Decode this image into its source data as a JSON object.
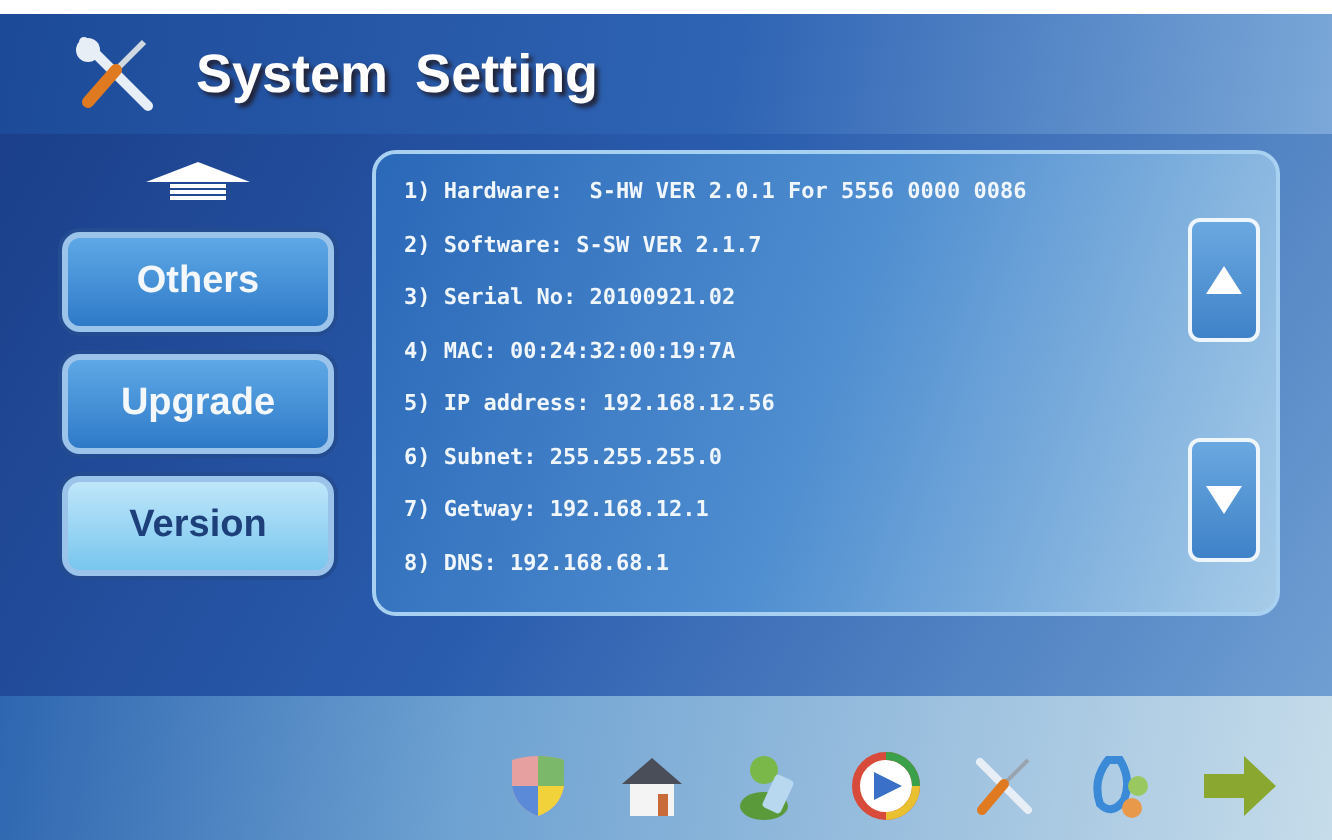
{
  "window": {
    "title": "System Setting"
  },
  "sidebar": {
    "items": [
      {
        "label": "Others",
        "selected": false
      },
      {
        "label": "Upgrade",
        "selected": false
      },
      {
        "label": "Version",
        "selected": true
      }
    ]
  },
  "info_lines": [
    "1) Hardware:  S-HW VER 2.0.1 For 5556 0000 0086",
    "2) Software: S-SW VER 2.1.7",
    "3) Serial No: 20100921.02",
    "4) MAC: 00:24:32:00:19:7A",
    "5) IP address: 192.168.12.56",
    "6) Subnet: 255.255.255.0",
    "7) Getway: 192.168.12.1",
    "8) DNS: 192.168.68.1"
  ]
}
